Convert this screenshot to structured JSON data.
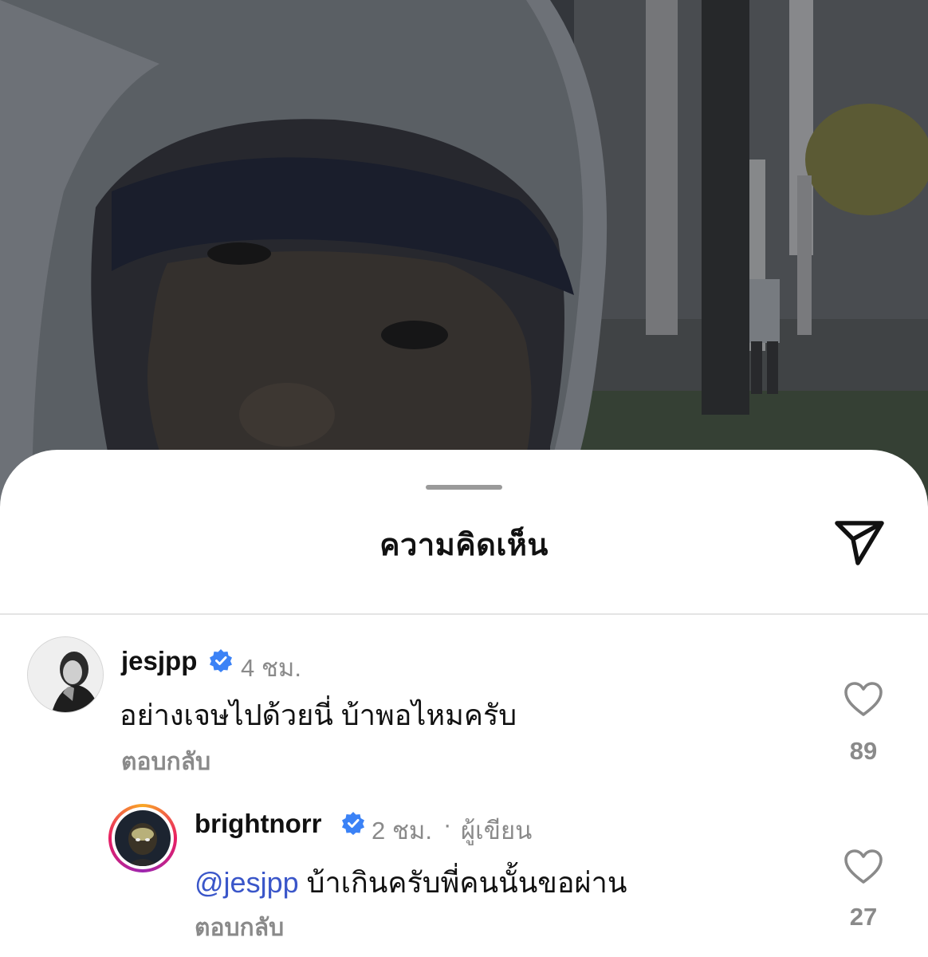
{
  "sheet": {
    "title": "ความคิดเห็น",
    "share_icon": "send-icon"
  },
  "comments": [
    {
      "username": "jesjpp",
      "verified": true,
      "time": "4 ชม.",
      "text": "อย่างเจษไปด้วยนี่ บ้าพอไหมครับ",
      "reply_label": "ตอบกลับ",
      "likes": "89"
    }
  ],
  "replies": [
    {
      "username": "brightnorr",
      "verified": true,
      "time": "2 ชม.",
      "separator": "·",
      "author_tag": "ผู้เขียน",
      "mention": "@jesjpp",
      "text": " บ้าเกินครับพี่คนนั้นขอผ่าน",
      "reply_label": "ตอบกลับ",
      "likes": "27"
    }
  ],
  "colors": {
    "mention": "#3a56c9",
    "verified_badge": "#3b82f6",
    "story_ring": [
      "#f9a825",
      "#e91e63",
      "#9c27b0"
    ]
  }
}
